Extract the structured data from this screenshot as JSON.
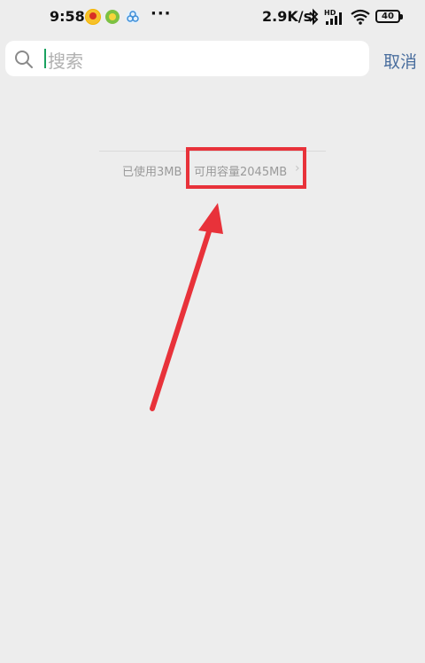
{
  "status_bar": {
    "time": "9:58",
    "app_icons": [
      "app-icon-1",
      "app-icon-2",
      "app-icon-3"
    ],
    "more_dots": "···",
    "net_speed": "2.9K/s",
    "signal_label": "HD",
    "battery": "40"
  },
  "search": {
    "placeholder": "搜索",
    "cancel_label": "取消"
  },
  "storage": {
    "used_label": "已使用3MB",
    "available_label": "可用容量2045MB",
    "chevron": "›"
  },
  "colors": {
    "background": "#ededed",
    "accent_link": "#4a6e9e",
    "annotation": "#e8323a",
    "caret": "#1aa260"
  }
}
